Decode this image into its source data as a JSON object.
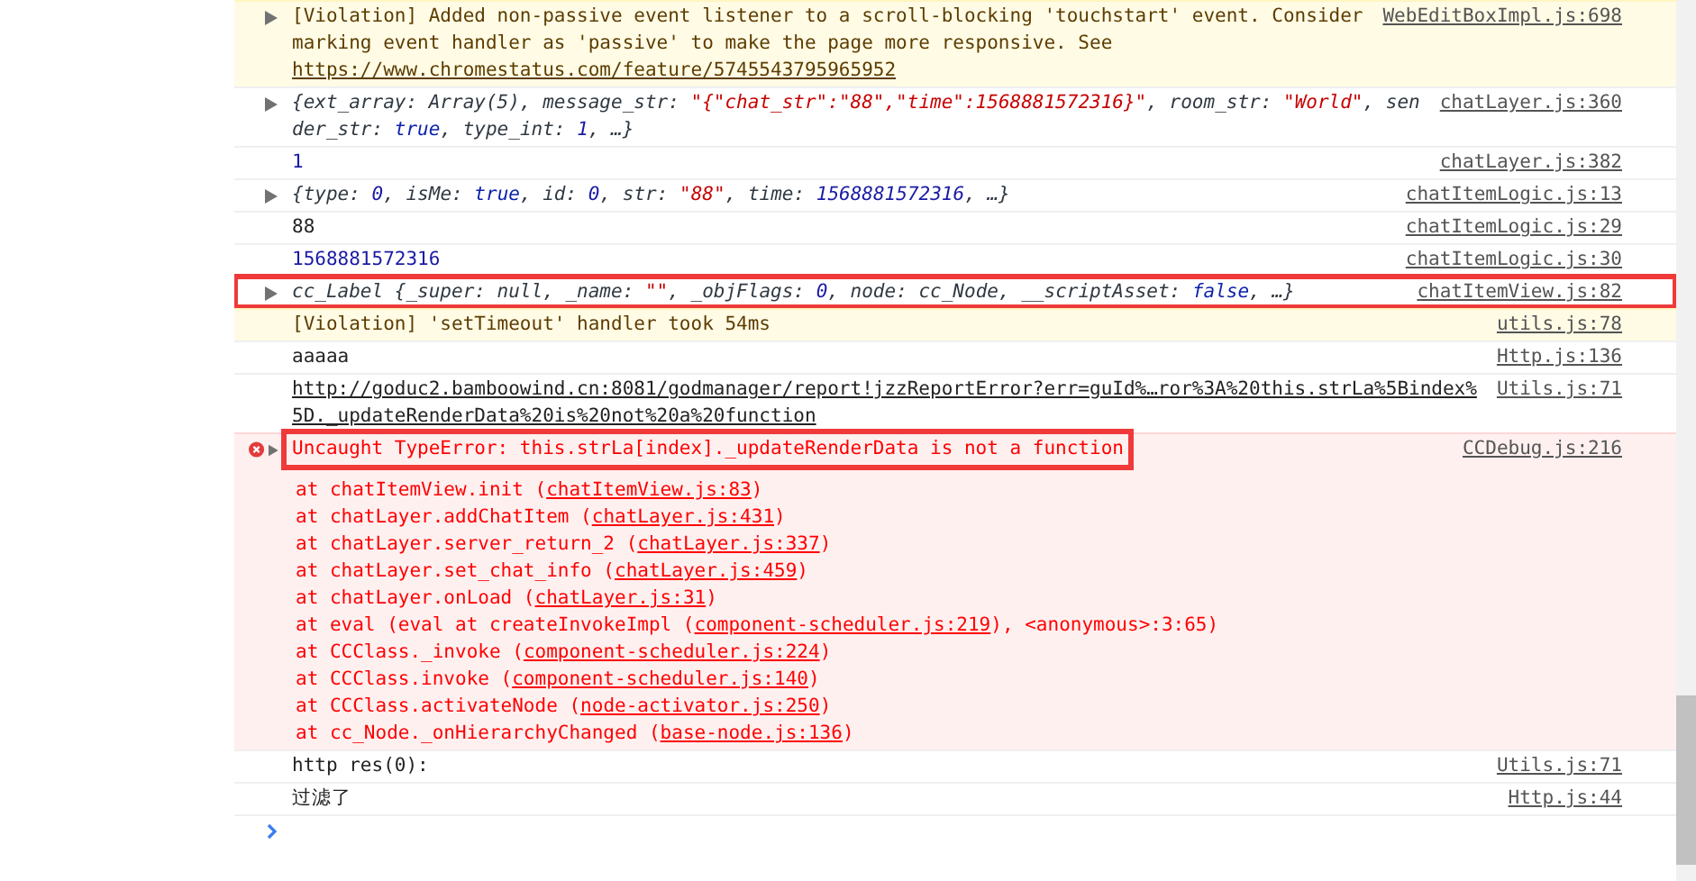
{
  "messages": [
    {
      "kind": "violation",
      "expandable": true,
      "text": "[Violation] Added non-passive event listener to a scroll-blocking 'touchstart' event. Consider marking event handler as 'passive' to make the page more responsive. See ",
      "link": "https://www.chromestatus.com/feature/5745543795965952",
      "source": "WebEditBoxImpl.js:698",
      "annotated": false
    },
    {
      "kind": "object",
      "expandable": true,
      "source": "chatLayer.js:360",
      "annotated": false,
      "tokens": [
        {
          "t": "{ext_array: Array(5), message_str: ",
          "kind": "plain"
        },
        {
          "t": "\"{\"chat_str\":\"88\",\"time\":1568881572316}\"",
          "kind": "string"
        },
        {
          "t": ", room_str: ",
          "kind": "plain"
        },
        {
          "t": "\"World\"",
          "kind": "string"
        },
        {
          "t": ", sender_str: ",
          "kind": "plain"
        },
        {
          "t": "true",
          "kind": "keyword"
        },
        {
          "t": ", type_int: ",
          "kind": "plain"
        },
        {
          "t": "1",
          "kind": "number"
        },
        {
          "t": ", …}",
          "kind": "plain"
        }
      ]
    },
    {
      "kind": "number",
      "text": "1",
      "source": "chatLayer.js:382",
      "annotated": false
    },
    {
      "kind": "object",
      "expandable": true,
      "source": "chatItemLogic.js:13",
      "annotated": false,
      "tokens": [
        {
          "t": "{type: ",
          "kind": "plain"
        },
        {
          "t": "0",
          "kind": "number"
        },
        {
          "t": ", isMe: ",
          "kind": "plain"
        },
        {
          "t": "true",
          "kind": "keyword"
        },
        {
          "t": ", id: ",
          "kind": "plain"
        },
        {
          "t": "0",
          "kind": "number"
        },
        {
          "t": ", str: ",
          "kind": "plain"
        },
        {
          "t": "\"88\"",
          "kind": "string"
        },
        {
          "t": ", time: ",
          "kind": "plain"
        },
        {
          "t": "1568881572316",
          "kind": "number"
        },
        {
          "t": ", …}",
          "kind": "plain"
        }
      ]
    },
    {
      "kind": "log",
      "text": "88",
      "source": "chatItemLogic.js:29",
      "annotated": false
    },
    {
      "kind": "number",
      "text": "1568881572316",
      "source": "chatItemLogic.js:30",
      "annotated": false
    },
    {
      "kind": "object",
      "expandable": true,
      "source": "chatItemView.js:82",
      "annotated": true,
      "tokens": [
        {
          "t": "cc_Label {_super: null, _name: ",
          "kind": "plain"
        },
        {
          "t": "\"\"",
          "kind": "string"
        },
        {
          "t": ", _objFlags: ",
          "kind": "plain"
        },
        {
          "t": "0",
          "kind": "number"
        },
        {
          "t": ", node: cc_Node, __scriptAsset: ",
          "kind": "plain"
        },
        {
          "t": "false",
          "kind": "keyword"
        },
        {
          "t": ", …}",
          "kind": "plain"
        }
      ]
    },
    {
      "kind": "violation",
      "expandable": false,
      "text": "[Violation] 'setTimeout' handler took 54ms",
      "source": "utils.js:78",
      "annotated": false
    },
    {
      "kind": "log",
      "text": "aaaaa",
      "source": "Http.js:136",
      "annotated": false
    },
    {
      "kind": "url",
      "link": "http://goduc2.bamboowind.cn:8081/godmanager/report!jzzReportError?err=guId%…ror%3A%20this.strLa%5Bindex%5D._updateRenderData%20is%20not%20a%20function",
      "source": "Utils.js:71",
      "annotated": false
    },
    {
      "kind": "error",
      "expandable": true,
      "text": "Uncaught TypeError: this.strLa[index]._updateRenderData is not a function",
      "source": "CCDebug.js:216",
      "annotated": true,
      "frames": [
        {
          "prefix": "at chatItemView.init (",
          "link": "chatItemView.js:83",
          "suffix": ")"
        },
        {
          "prefix": "at chatLayer.addChatItem (",
          "link": "chatLayer.js:431",
          "suffix": ")"
        },
        {
          "prefix": "at chatLayer.server_return_2 (",
          "link": "chatLayer.js:337",
          "suffix": ")"
        },
        {
          "prefix": "at chatLayer.set_chat_info (",
          "link": "chatLayer.js:459",
          "suffix": ")"
        },
        {
          "prefix": "at chatLayer.onLoad (",
          "link": "chatLayer.js:31",
          "suffix": ")"
        },
        {
          "prefix": "at eval (eval at createInvokeImpl (",
          "link": "component-scheduler.js:219",
          "suffix": "), <anonymous>:3:65)"
        },
        {
          "prefix": "at CCClass._invoke (",
          "link": "component-scheduler.js:224",
          "suffix": ")"
        },
        {
          "prefix": "at CCClass.invoke (",
          "link": "component-scheduler.js:140",
          "suffix": ")"
        },
        {
          "prefix": "at CCClass.activateNode (",
          "link": "node-activator.js:250",
          "suffix": ")"
        },
        {
          "prefix": "at cc_Node._onHierarchyChanged (",
          "link": "base-node.js:136",
          "suffix": ")"
        }
      ]
    },
    {
      "kind": "log",
      "text": "http res(0):",
      "source": "Utils.js:71",
      "annotated": false
    },
    {
      "kind": "log",
      "text": "过滤了",
      "source": "Http.js:44",
      "annotated": false
    }
  ]
}
